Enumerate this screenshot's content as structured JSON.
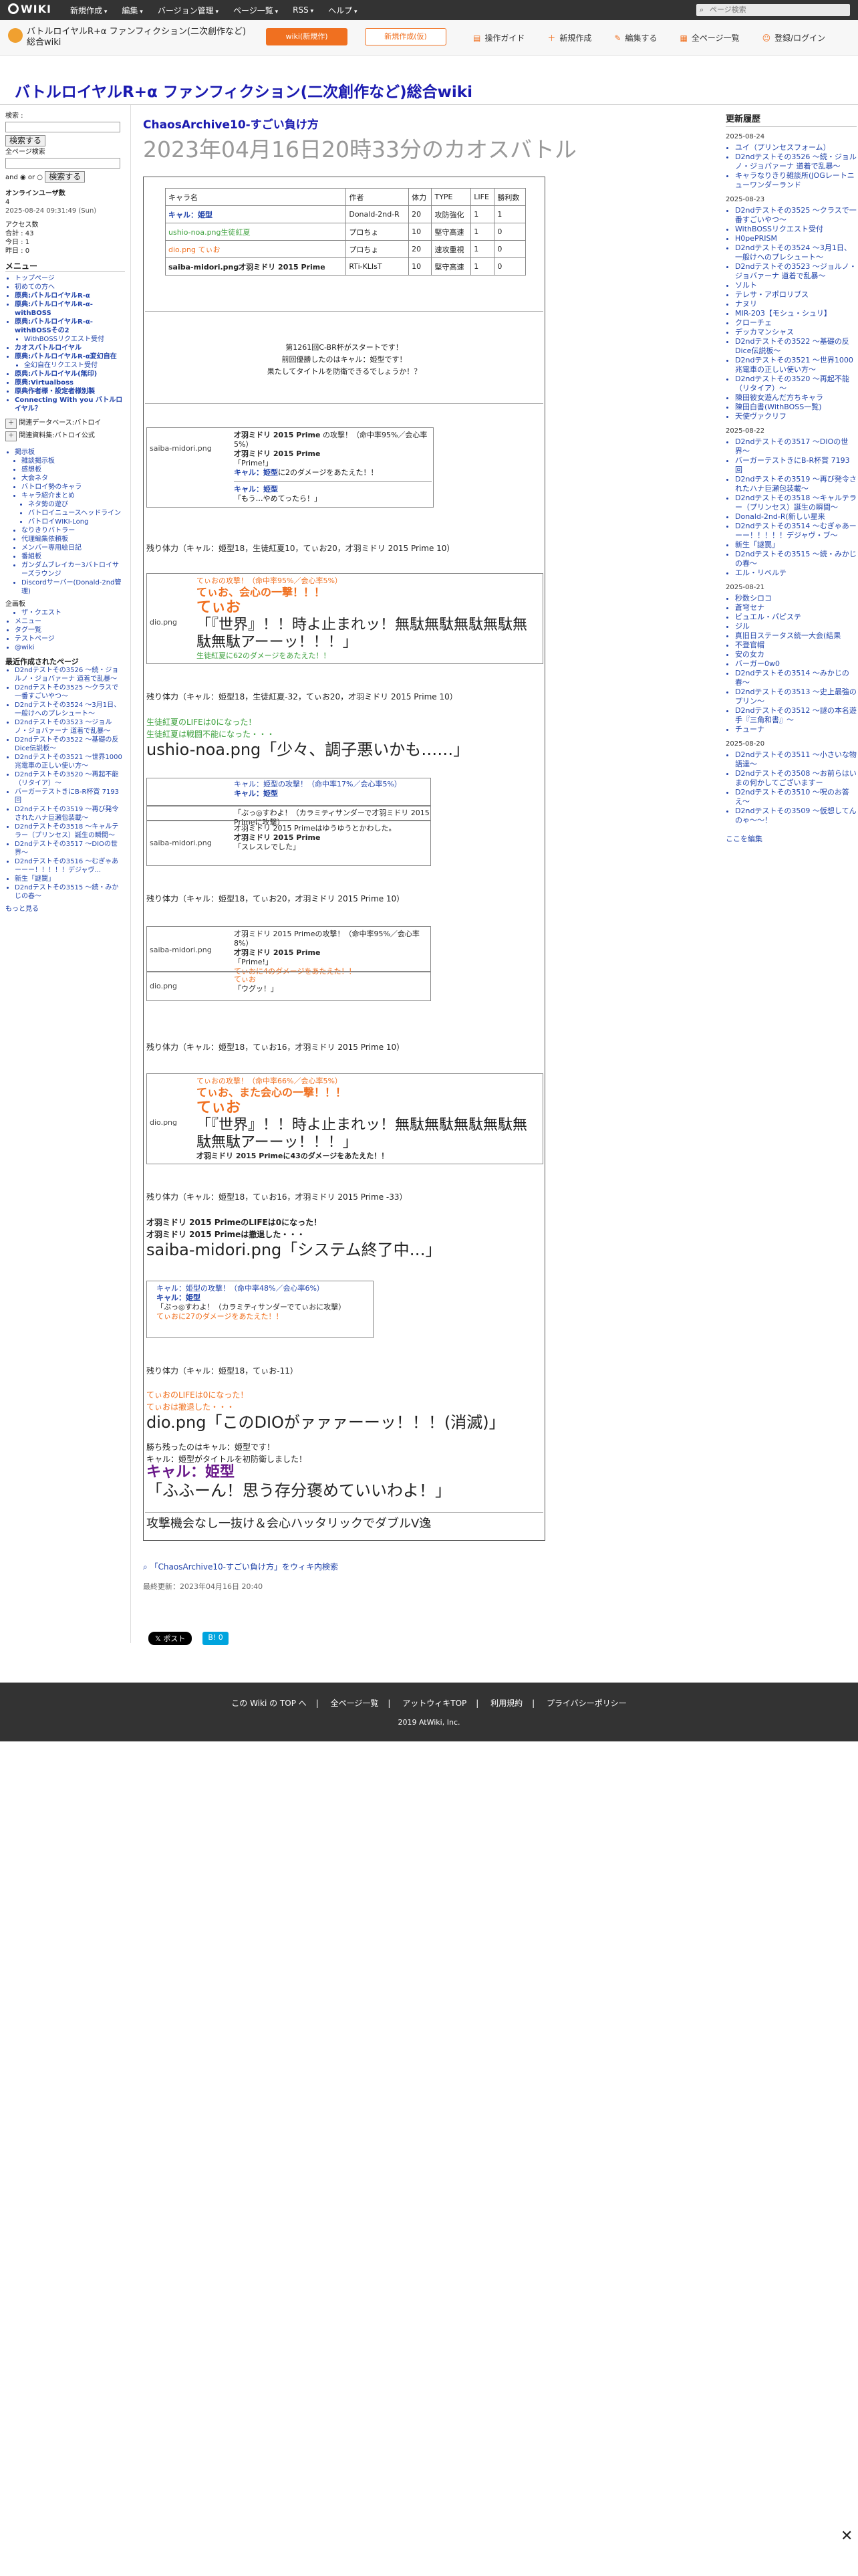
{
  "topbar": {
    "logo": "WIKI",
    "menus": [
      "新規作成",
      "編集",
      "バージョン管理",
      "ページ一覧",
      "RSS",
      "ヘルプ"
    ],
    "search_placeholder": "ページ検索"
  },
  "bar2": {
    "wiki_name": "バトルロイヤルR+α ファンフィクション(二次創作など)総合wiki",
    "btn_primary": "wiki(新規作)",
    "btn_secondary": "新規作成(仮)",
    "tools": [
      "操作ガイド",
      "新規作成",
      "編集する",
      "全ページ一覧",
      "登録/ログイン"
    ]
  },
  "wiki_title": "バトルロイヤルR+α ファンフィクション(二次創作など)総合wiki",
  "left": {
    "search_label": "検索 :",
    "search_btn": "検索する",
    "sub_label": "全ページ検索",
    "and_or": "and ◉ or ○",
    "search_btn2": "検索する",
    "online_label": "オンラインユーザ数",
    "online_count": "4",
    "timestamp": "2025-08-24 09:31:49 (Sun)",
    "access_label": "アクセス数",
    "access_total": "合計 : 43",
    "access_today": "今日 : 1",
    "access_yesterday": "昨日 : 0",
    "menu_heading": "メニュー",
    "menu_items": [
      "トップページ",
      "初めての方へ",
      "原典:バトルロイヤルR-α",
      "原典:バトルロイヤルR-α-withBOSS",
      "原典:バトルロイヤルR-α-withBOSSその2",
      "WithBOSSリクエスト受付",
      "カオスバトルロイヤル",
      "原典:バトルロイヤルR-α変幻自在",
      "全幻自在リクエスト受付",
      "原典:バトルロイヤル(無印)",
      "原典:Virtualboss",
      "原典作者様・設定者様別製",
      "Connecting With you バトルロイヤル？"
    ],
    "btn_a": "関連データベース:バトロイ",
    "btn_b": "関連資料集:バトロイ公式",
    "sub_items": [
      "掲示板",
      "雑談掲示板",
      "感想板",
      "大会ネタ",
      "バトロイ勢のキャラ",
      "キャラ紹介まとめ",
      "ネタ勢の遊び",
      "バトロイニュースヘッドライン",
      "バトロイWIKI-Long",
      "なりきりバトラー",
      "代理編集依頼板",
      "メンバー専用絵日記",
      "番組板",
      "ガンダムブレイカー3バトロイサーズラウンジ",
      "Discordサーバー(Donald-2nd管理)"
    ],
    "extra_heading": "企画板",
    "extra_items": [
      "ザ・クエスト",
      "メニュー",
      "タグ一覧",
      "テストページ",
      "@wiki"
    ],
    "recent_heading": "最近作成されたページ",
    "recent_items": [
      "D2ndテストその3526 〜続・ジョルノ・ジョバァーナ 道着で乱暴〜",
      "D2ndテストその3525 〜クラスで一番すごいやつ〜",
      "D2ndテストその3524 〜3月1日、一般けへのプレシュート〜",
      "D2ndテストその3523 〜ジョルノ・ジョバァーナ 道着で乱暴〜",
      "D2ndテストその3522 〜基礎の反Dice伝説板〜",
      "D2ndテストその3521 〜世界1000兆電車の正しい使い方〜",
      "D2ndテストその3520 〜再起不能（リタイア）〜",
      "バーガーテストきにB-R杯賞 7193回",
      "D2ndテストその3519 〜再び発令されたハナ巨瀬包装載〜",
      "D2ndテストその3518 〜キャルテラー（プリンセス）誕生の瞬間〜",
      "D2ndテストその3517 〜DIOの世界〜",
      "D2ndテストその3516 〜むぎゃあーーー！！！！！デジャヴ...",
      "新生「謎罠」",
      "D2ndテストその3515 〜続・みかじの春〜"
    ],
    "more": "もっと見る"
  },
  "main": {
    "supertitle": "ChaosArchive10-すごい負け方",
    "page_title": "2023年04月16日20時33分のカオスバトル"
  },
  "table": {
    "headers": [
      "キャラ名",
      "作者",
      "体力",
      "TYPE",
      "LIFE",
      "勝利数"
    ],
    "rows": [
      [
        "キャル：姫型",
        "Donald-2nd-R",
        "20",
        "攻防強化",
        "1",
        "1"
      ],
      [
        "ushio-noa.png生徒紅夏",
        "プロちょ",
        "10",
        "堅守高速",
        "1",
        "0"
      ],
      [
        "dio.png てぃお",
        "プロちょ",
        "20",
        "速攻重視",
        "1",
        "0"
      ],
      [
        "saiba-midori.png才羽ミドリ 2015 Prime",
        "RTi-KLIsT",
        "10",
        "堅守高速",
        "1",
        "0"
      ]
    ]
  },
  "intro": {
    "line1": "第1261回C-BR杯がスタートです！",
    "line2": "前回優勝したのはキャル：姫型です！",
    "line3": "果たしてタイトルを防衛できるでしょうか！？"
  },
  "battle": {
    "b1_pic": "saiba-midori.png",
    "b1_name": "才羽ミドリ 2015 Prime",
    "b1_attack": "の攻撃！（命中率95%／会心率5%）",
    "b1_name2": "才羽ミドリ 2015 Prime",
    "b1_prime": "「Prime!」",
    "b1_dmg_target": "キャル：姫型",
    "b1_dmg": "に2のダメージをあたえた！！",
    "b1_reply_name": "キャル：姫型",
    "b1_reply": "「もう…やめてったら！」",
    "hp1": "残り体力（キャル：姫型18，生徒紅夏10，てぃお20，才羽ミドリ 2015 Prime 10）",
    "b2_pic": "dio.png",
    "b2_attack": "てぃおの攻撃！（命中率95%／会心率5%）",
    "b2_crit": "てぃお、会心の一撃！！！",
    "b2_name": "てぃお",
    "b2_quote": "「『世界』！！時よ止まれッ！無駄無駄無駄無駄無駄無駄アーーッ！！！」",
    "b2_dmg": "生徒紅夏に62のダメージをあたえた！！",
    "hp2": "残り体力（キャル：姫型18，生徒紅夏-32，てぃお20，才羽ミドリ 2015 Prime 10）",
    "ko1a": "生徒紅夏のLIFEは0になった！",
    "ko1b": "生徒紅夏は戦闘不能になった・・・",
    "ko1_quote": "ushio-noa.png「少々、調子悪いかも……」",
    "b3_line1": "キャル：姫型の攻撃！（命中率17%／会心率5%）",
    "b3_line2": "キャル：姫型",
    "b3_line3": "「ぷっ◎すわよ！（カラミティサンダーで才羽ミドリ 2015 Primeに攻撃）",
    "b3_pic": "saiba-midori.png",
    "b3_dodge": "才羽ミドリ 2015 Primeはゆうゆうとかわした。",
    "b3_name": "才羽ミドリ 2015 Prime",
    "b3_quote": "「スレスレでした」",
    "hp3": "残り体力（キャル：姫型18，てぃお20，才羽ミドリ 2015 Prime 10）",
    "b4_pic": "saiba-midori.png",
    "b4_line1": "才羽ミドリ 2015 Primeの攻撃！（命中率95%／会心率8%）",
    "b4_line2": "才羽ミドリ 2015 Prime",
    "b4_prime": "「Prime!」",
    "b4_dmg": "てぃおに4のダメージをあたえた！！",
    "b4_pic2": "dio.png",
    "b4_reply_name": "てぃお",
    "b4_reply": "「ウグッ！」",
    "hp4": "残り体力（キャル：姫型18，てぃお16，才羽ミドリ 2015 Prime 10）",
    "b5_pic": "dio.png",
    "b5_attack": "てぃおの攻撃！（命中率66%／会心率5%）",
    "b5_crit": "てぃお、また会心の一撃！！！",
    "b5_name": "てぃお",
    "b5_quote": "「『世界』！！時よ止まれッ！無駄無駄無駄無駄無駄無駄アーーッ！！！」",
    "b5_dmg": "才羽ミドリ 2015 Primeに43のダメージをあたえた！！",
    "hp5": "残り体力（キャル：姫型18，てぃお16，才羽ミドリ 2015 Prime -33）",
    "ko2a": "才羽ミドリ 2015 PrimeのLIFEは0になった！",
    "ko2b": "才羽ミドリ 2015 Primeは撤退した・・・",
    "ko2_quote": "saiba-midori.png「システム終了中…」",
    "b6_line1": "キャル：姫型の攻撃！（命中率48%／会心率6%）",
    "b6_line2": "キャル：姫型",
    "b6_line3": "「ぷっ◎すわよ！（カラミティサンダーでてぃおに攻撃）",
    "b6_dmg": "てぃおに27のダメージをあたえた！！",
    "hp6": "残り体力（キャル：姫型18，てぃお-11）",
    "ko3a": "てぃおのLIFEは0になった！",
    "ko3b": "てぃおは撤退した・・・",
    "ko3_quote": "dio.png「このDIOがァァァーーッ！！！(消滅)」",
    "win1": "勝ち残ったのはキャル：姫型です！",
    "win2": "キャル：姫型がタイトルを初防衛しました！",
    "win_name": "キャル：姫型",
    "win_quote": "「ふふーん！思う存分褒めていいわよ！」",
    "summary": "攻撃機会なし一抜け＆会心ハッタリックでダブルV逸"
  },
  "footer_meta": {
    "related": "「ChaosArchive10-すごい負け方」をウィキ内検索",
    "updated": "最終更新：2023年04月16日 20:40",
    "share_x": "ポスト",
    "share_hatena": "B! 0"
  },
  "right": {
    "heading": "更新履歴",
    "groups": [
      {
        "date": "2025-08-24",
        "items": [
          "ユイ（プリンセスフォーム）",
          "D2ndテストその3526 〜続・ジョルノ・ジョバァーナ 道着で乱暴〜",
          "キャラなりきり雑談所(JOGレートニューワンダーランド"
        ]
      },
      {
        "date": "2025-08-23",
        "items": [
          "D2ndテストその3525 〜クラスで一番すごいやつ〜",
          "WithBOSSリクエスト受付",
          "H0pePRISM",
          "D2ndテストその3524 〜3月1日、一般けへのプレシュート〜",
          "D2ndテストその3523 〜ジョルノ・ジョバァーナ 道着で乱暴〜",
          "ソルト",
          "テレサ・アポロリブス",
          "ナヌリ",
          "MIR-203【モシュ・シュリ】",
          "クローチェ",
          "デッカマンシャス",
          "D2ndテストその3522 〜基礎の反Dice伝説板〜",
          "D2ndテストその3521 〜世界1000兆電車の正しい使い方〜",
          "D2ndテストその3520 〜再起不能（リタイア）〜",
          "陳田彼女遊んだ方ちキャラ",
          "陳田白書(WithBOSS一覧)",
          "天使ヴァクリフ"
        ]
      },
      {
        "date": "2025-08-22",
        "items": [
          "D2ndテストその3517 〜DIOの世界〜",
          "バーガーテストきにB-R杯賞 7193回",
          "D2ndテストその3519 〜再び発令されたハナ巨瀬包装載〜",
          "D2ndテストその3518 〜キャルテラー（プリンセス）誕生の瞬間〜",
          "Donald-2nd-R(新しい星来",
          "D2ndテストその3514 〜むぎゃあーーー！！！！！デジャヴ・ブ〜",
          "新生「謎罠」",
          "D2ndテストその3515 〜続・みかじの春〜",
          "エル・リベルテ"
        ]
      },
      {
        "date": "2025-08-21",
        "items": [
          "秒数シロコ",
          "蒼穹セナ",
          "ビュエル・パピステ",
          "ジル",
          "真旧日ステータス統一大会(結果",
          "不登官帽",
          "安の女カ",
          "バーガー0w0",
          "D2ndテストその3514 〜みかじの春〜",
          "D2ndテストその3513 〜史上最強のプリン〜",
          "D2ndテストその3512 〜謎の本名遊手『三角和書』〜",
          "チューナ"
        ]
      },
      {
        "date": "2025-08-20",
        "items": [
          "D2ndテストその3511 〜小さいな物語達〜",
          "D2ndテストその3508 〜お前らはいまの何かしてございますー",
          "D2ndテストその3510 〜呪のお答え〜",
          "D2ndテストその3509 〜仮想してんのゃ〜〜！"
        ]
      }
    ],
    "edit_link": "ここを編集"
  },
  "footer": {
    "links": [
      "この Wiki の TOP へ",
      "全ページ一覧",
      "アットウィキTOP",
      "利用規約",
      "プライバシーポリシー"
    ],
    "copy": "2019 AtWiki, Inc."
  }
}
